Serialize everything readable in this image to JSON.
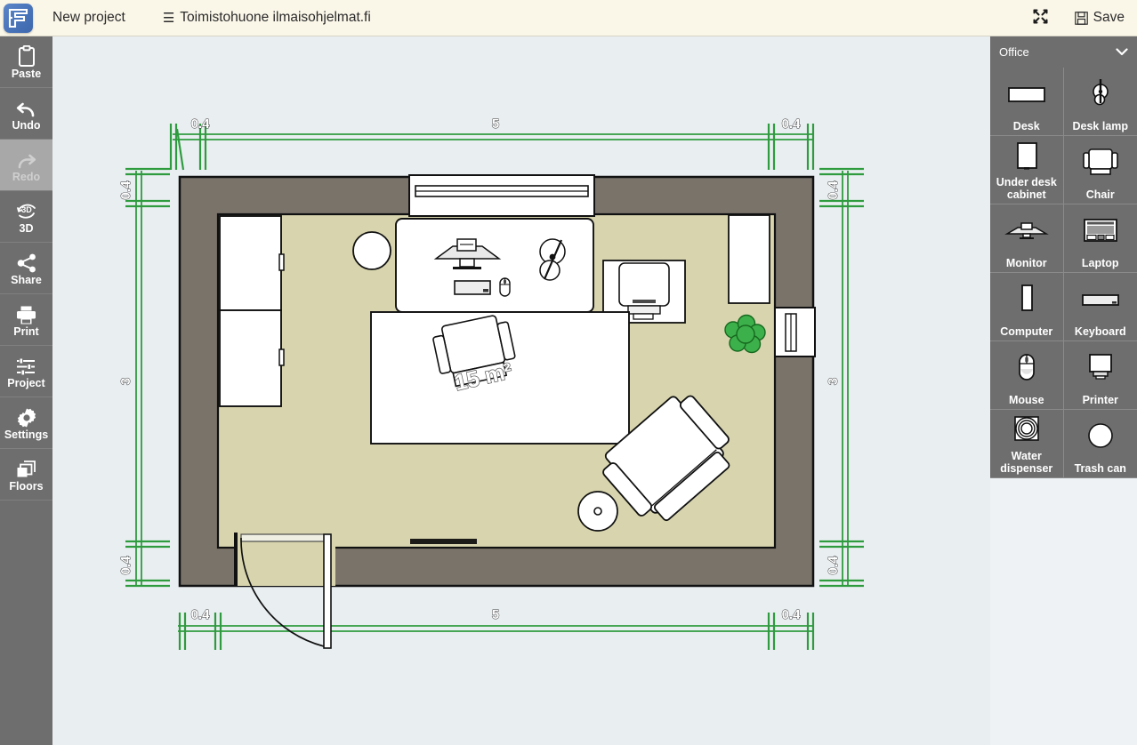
{
  "header": {
    "logo_icon": "floorplan-logo-icon",
    "new_project_label": "New project",
    "burger_icon": "☰",
    "project_title": "Toimistohuone ilmaisohjelmat.fi",
    "fullscreen_icon": "✥",
    "save_icon": "💾",
    "save_label": "Save"
  },
  "sidebar": {
    "items": [
      {
        "label": "Paste",
        "icon": "clipboard-icon",
        "disabled": false
      },
      {
        "label": "Undo",
        "icon": "undo-arrow-icon",
        "disabled": false
      },
      {
        "label": "Redo",
        "icon": "redo-arrow-icon",
        "disabled": true
      },
      {
        "label": "3D",
        "icon": "3d-rotate-icon",
        "disabled": false
      },
      {
        "label": "Share",
        "icon": "share-nodes-icon",
        "disabled": false
      },
      {
        "label": "Print",
        "icon": "printer-icon",
        "disabled": false
      },
      {
        "label": "Project",
        "icon": "sliders-icon",
        "disabled": false
      },
      {
        "label": "Settings",
        "icon": "gear-icon",
        "disabled": false
      },
      {
        "label": "Floors",
        "icon": "layers-icon",
        "disabled": false
      }
    ]
  },
  "catalog": {
    "selected_category": "Office",
    "chevron_icon": "⌄",
    "items": [
      {
        "label": "Desk",
        "icon": "desk-icon"
      },
      {
        "label": "Desk lamp",
        "icon": "desk-lamp-icon"
      },
      {
        "label": "Under desk cabinet",
        "icon": "cabinet-icon"
      },
      {
        "label": "Chair",
        "icon": "chair-icon"
      },
      {
        "label": "Monitor",
        "icon": "monitor-icon"
      },
      {
        "label": "Laptop",
        "icon": "laptop-icon"
      },
      {
        "label": "Computer",
        "icon": "computer-tower-icon"
      },
      {
        "label": "Keyboard",
        "icon": "keyboard-icon"
      },
      {
        "label": "Mouse",
        "icon": "mouse-icon"
      },
      {
        "label": "Printer",
        "icon": "printer-item-icon"
      },
      {
        "label": "Water dispenser",
        "icon": "water-dispenser-icon"
      },
      {
        "label": "Trash can",
        "icon": "trash-can-icon"
      }
    ]
  },
  "floorplan": {
    "room_area_label": "15 m²",
    "dimensions": {
      "top": [
        "0.4",
        "5",
        "0.4"
      ],
      "bottom": [
        "0.4",
        "5",
        "0.4"
      ],
      "left": [
        "0.4",
        "3",
        "0.4"
      ],
      "right": [
        "0.4",
        "3",
        "0.4"
      ]
    },
    "colors": {
      "wall": "#79736a",
      "wall_outline": "#111111",
      "floor": "#d8d5ae",
      "canvas_bg": "#e9eef1",
      "dimension_green": "#2f9b3f",
      "plant_green": "#3cb04a",
      "furniture_fill": "#ffffff"
    },
    "objects": [
      "window-top",
      "window-right",
      "door-bottom",
      "desk",
      "monitor",
      "keyboard",
      "mouse",
      "desk-lamp",
      "cabinet-upper",
      "cabinet-lower",
      "round-table",
      "printer-table",
      "printer",
      "plant",
      "table-large",
      "chair",
      "armchair",
      "trash-can"
    ]
  }
}
